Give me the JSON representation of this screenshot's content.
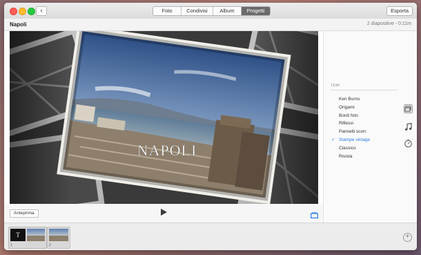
{
  "toolbar": {
    "tabs": [
      {
        "label": "Foto"
      },
      {
        "label": "Condivisi"
      },
      {
        "label": "Album"
      },
      {
        "label": "Progetti"
      }
    ],
    "export_label": "Esporta"
  },
  "project": {
    "title": "Napoli",
    "info": "2 diapositive - 0:11m"
  },
  "slide": {
    "title_text": "Napoli"
  },
  "controls": {
    "preview_label": "Anteprima"
  },
  "themes": {
    "header": "TEMI",
    "items": [
      {
        "label": "Ken Burns"
      },
      {
        "label": "Origami"
      },
      {
        "label": "Bordi foto"
      },
      {
        "label": "Riflessi"
      },
      {
        "label": "Pannelli scorr."
      },
      {
        "label": "Stampe vintage"
      },
      {
        "label": "Classico"
      },
      {
        "label": "Rivista"
      }
    ],
    "selected_index": 5
  },
  "filmstrip": {
    "slides": [
      {
        "number": "1",
        "thumb_letter": "T"
      },
      {
        "number": "2"
      }
    ]
  },
  "icons": {
    "theme_panel": "slides-icon",
    "music": "music-note-icon",
    "duration": "timer-icon",
    "add": "plus-circle-icon"
  },
  "colors": {
    "accent": "#2a7de1",
    "active_tab": "#6b6b6b"
  }
}
